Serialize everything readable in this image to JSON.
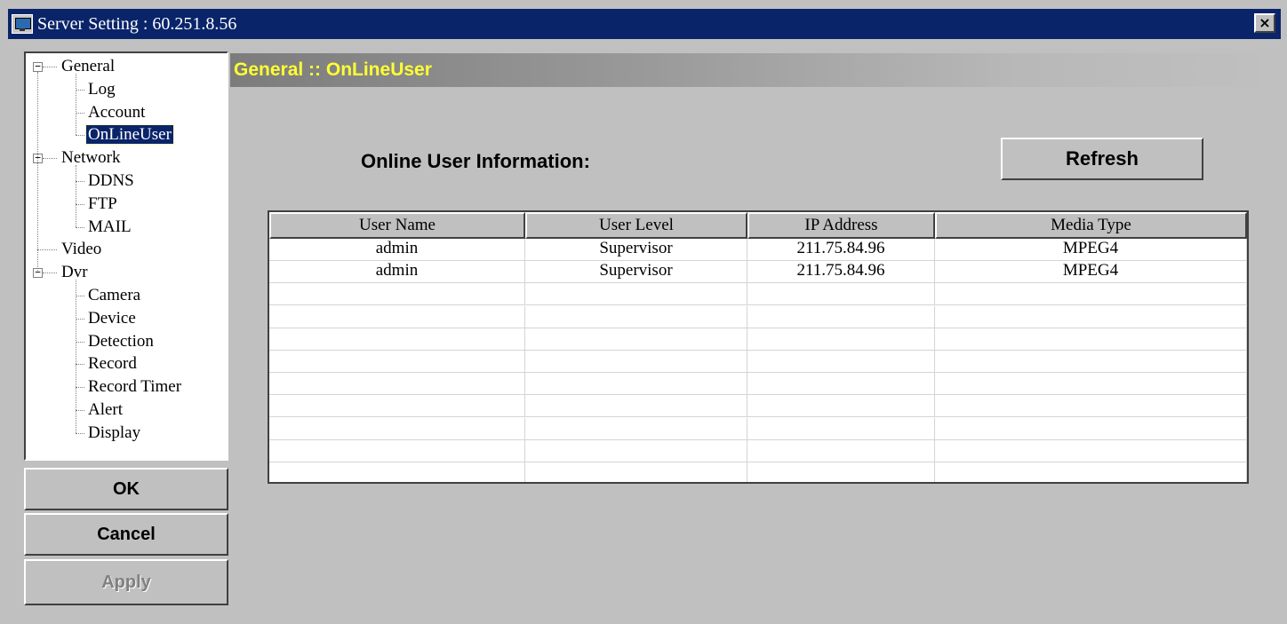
{
  "window": {
    "title": "Server Setting : 60.251.8.56",
    "close_glyph": "×"
  },
  "tree": {
    "items": [
      {
        "label": "General",
        "expander": "−"
      },
      {
        "label": "Log"
      },
      {
        "label": "Account"
      },
      {
        "label": "OnLineUser",
        "selected": true
      },
      {
        "label": "Network",
        "expander": "−"
      },
      {
        "label": "DDNS"
      },
      {
        "label": "FTP"
      },
      {
        "label": "MAIL"
      },
      {
        "label": "Video"
      },
      {
        "label": "Dvr",
        "expander": "−"
      },
      {
        "label": "Camera"
      },
      {
        "label": "Device"
      },
      {
        "label": "Detection"
      },
      {
        "label": "Record"
      },
      {
        "label": "Record Timer"
      },
      {
        "label": "Alert"
      },
      {
        "label": "Display"
      }
    ]
  },
  "buttons": {
    "ok": "OK",
    "cancel": "Cancel",
    "apply": "Apply",
    "refresh": "Refresh"
  },
  "panel": {
    "header": "General :: OnLineUser",
    "section_label": "Online User Information:"
  },
  "table": {
    "columns": [
      "User Name",
      "User Level",
      "IP Address",
      "Media Type"
    ],
    "rows": [
      [
        "admin",
        "Supervisor",
        "211.75.84.96",
        "MPEG4"
      ],
      [
        "admin",
        "Supervisor",
        "211.75.84.96",
        "MPEG4"
      ]
    ],
    "empty_rows": 9
  },
  "colors": {
    "title_bar": "#0a246a",
    "header_text": "#ffff33",
    "window_face": "#c0c0c0"
  }
}
